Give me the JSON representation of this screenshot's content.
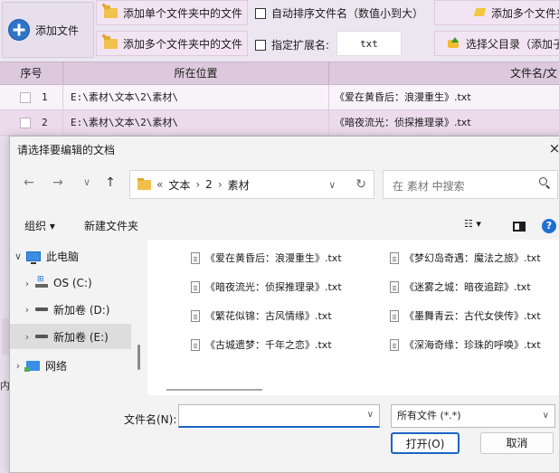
{
  "app": {
    "toolbar": {
      "add_file": "添加文件",
      "add_single_folder": "添加单个文件夹中的文件",
      "add_multi_folder": "添加多个文件夹中的文件",
      "auto_sort": "自动排序文件名（数值小到大）",
      "ext_label": "指定扩展名:",
      "ext_value": "txt",
      "add_multi_files_cut": "添加多个文件夹",
      "choose_parent_cut": "选择父目录（添加子"
    },
    "grid": {
      "headers": [
        "序号",
        "所在位置",
        "文件名/文"
      ],
      "rows": [
        {
          "index": "1",
          "location": "E:\\素材\\文本\\2\\素材\\",
          "filename": "《爱在黄昏后：浪漫重生》.txt"
        },
        {
          "index": "2",
          "location": "E:\\素材\\文本\\2\\素材\\",
          "filename": "《暗夜流光：侦探推理录》.txt"
        }
      ]
    },
    "side_fragment": "内"
  },
  "dialog": {
    "title": "请选择要编辑的文档",
    "close_glyph": "×",
    "nav": {
      "back": "←",
      "forward": "→",
      "recent": "∨",
      "up": "↑"
    },
    "address": {
      "prefix": "«",
      "parts": [
        "文本",
        "2",
        "素材"
      ],
      "separator": "›",
      "dropdown": "∨",
      "refresh": "↻"
    },
    "search_placeholder": "在 素材 中搜索",
    "commands": {
      "organize": "组织 ▾",
      "new_folder": "新建文件夹",
      "view": "☷ ▾"
    },
    "tree": [
      {
        "label": "此电脑",
        "chevron": "∨",
        "icon": "pc"
      },
      {
        "label": "OS (C:)",
        "chevron": "›",
        "icon": "os"
      },
      {
        "label": "新加卷 (D:)",
        "chevron": "›",
        "icon": "drive"
      },
      {
        "label": "新加卷 (E:)",
        "chevron": "›",
        "icon": "drive",
        "selected": true
      },
      {
        "label": "网络",
        "chevron": "›",
        "icon": "network"
      }
    ],
    "files": [
      "《爱在黄昏后：浪漫重生》.txt",
      "《暗夜流光：侦探推理录》.txt",
      "《繁花似锦：古风情缘》.txt",
      "《古城遗梦：千年之恋》.txt",
      "《梦幻岛奇遇：魔法之旅》.txt",
      "《迷雾之城：暗夜追踪》.txt",
      "《墨舞青云：古代女侠传》.txt",
      "《深海奇缘：珍珠的呼唤》.txt"
    ],
    "filename_label": "文件名(N):",
    "filename_value": "",
    "filetype": "所有文件 (*.*)",
    "open_label": "打开(O)",
    "cancel_label": "取消",
    "dropdown_glyph": "∨"
  }
}
